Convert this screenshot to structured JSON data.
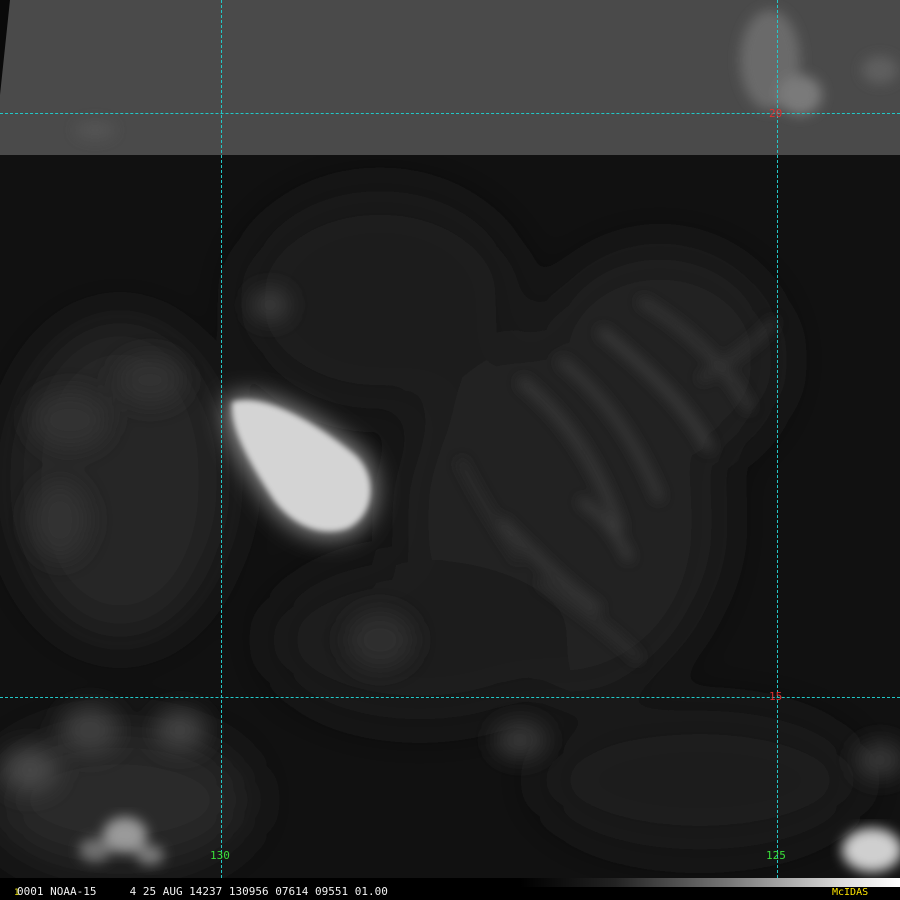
{
  "grid_labels": {
    "lat_north": "20",
    "lat_south": "15",
    "lon_west": "130",
    "lon_east": "125"
  },
  "status_line": {
    "frame_number": "1",
    "text": "0001 NOAA-15     4 25 AUG 14237 130956 07614 09551 01.00"
  },
  "logo_text": "McIDAS",
  "colors": {
    "grid_lines": "#22c8c8",
    "latitude_labels": "#e03030",
    "longitude_labels": "#3adf3a",
    "logo": "#ffe600"
  }
}
